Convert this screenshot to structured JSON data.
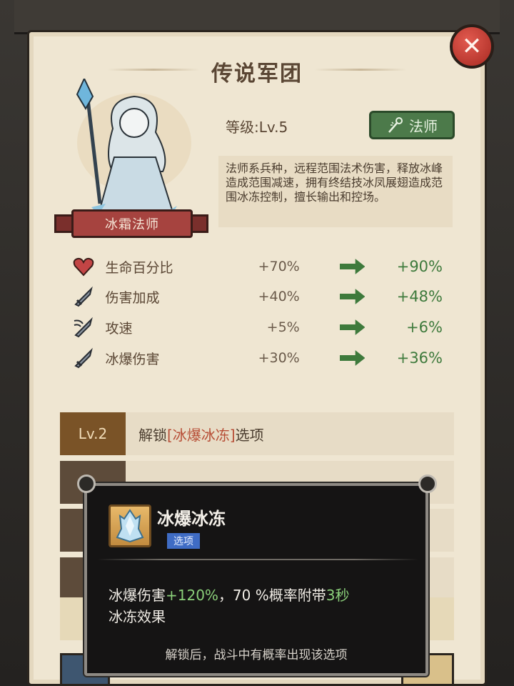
{
  "panel": {
    "title": "传说军团",
    "close_icon": "close-icon"
  },
  "hero": {
    "name": "冰霜法师",
    "level": "等级:Lv.5",
    "class_label": "法师",
    "class_icon": "staff-icon",
    "description": "法师系兵种，远程范围法术伤害，释放冰峰造成范围减速，拥有终结技冰凤展翅造成范围冰冻控制，擅长输出和控场。"
  },
  "stats": [
    {
      "icon": "heart-icon",
      "label": "生命百分比",
      "current": "+70%",
      "next": "+90%"
    },
    {
      "icon": "sword-icon",
      "label": "伤害加成",
      "current": "+40%",
      "next": "+48%"
    },
    {
      "icon": "swift-sword-icon",
      "label": "攻速",
      "current": "+5%",
      "next": "+6%"
    },
    {
      "icon": "sword-icon",
      "label": "冰爆伤害",
      "current": "+30%",
      "next": "+36%"
    }
  ],
  "unlocks": [
    {
      "level": "Lv.2",
      "prefix": "解锁",
      "highlight": "[冰爆冰冻]",
      "suffix": "选项"
    }
  ],
  "tooltip": {
    "skill_name": "冰爆冰冻",
    "tag": "选项",
    "desc_part1": "冰爆伤害",
    "desc_value1": "+120%",
    "desc_part2": "，70 %概率附带",
    "desc_value2": "3秒",
    "desc_part3": "冰冻效果",
    "footer": "解锁后，战斗中有概率出现该选项"
  },
  "colors": {
    "parchment": "#efe6d2",
    "accent_green": "#3e7a3c",
    "ribbon_red": "#a6433f",
    "level_tag_brown": "#7a5327",
    "tooltip_bg": "#151414"
  }
}
